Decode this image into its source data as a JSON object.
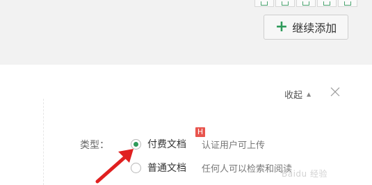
{
  "toolbar": {
    "add_button_label": "继续添加",
    "add_button_icon": "plus-icon",
    "accent_color": "#2e9a5a"
  },
  "panel": {
    "collapse_label": "收起",
    "collapse_icon": "caret-up-icon",
    "close_icon": "close-icon"
  },
  "doc_type": {
    "label": "类型：",
    "options": [
      {
        "name": "付费文档",
        "desc": "认证用户可上传",
        "selected": true,
        "badge": "H"
      },
      {
        "name": "普通文档",
        "desc": "任何人可以检索和阅读",
        "selected": false
      }
    ]
  },
  "annotation": {
    "arrow_color": "#e02020"
  },
  "watermark": "Baidu 经验"
}
